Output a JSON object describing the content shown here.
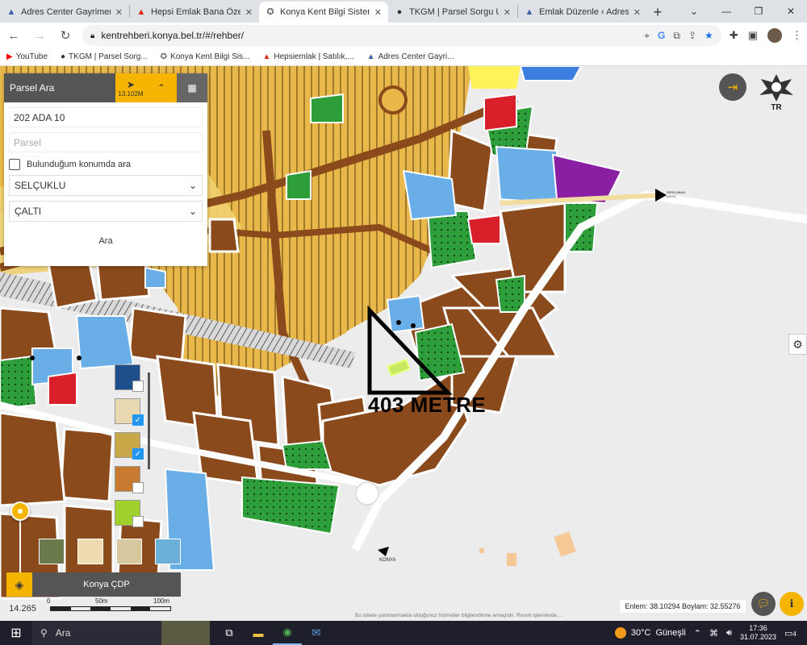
{
  "browser": {
    "tabs": [
      {
        "title": "Adres Center Gayrimenkul",
        "icon": "adres-center-icon",
        "active": false
      },
      {
        "title": "Hepsi Emlak Bana Özel",
        "icon": "hepsiemlak-icon",
        "active": false
      },
      {
        "title": "Konya Kent Bilgi Sistemi",
        "icon": "konya-icon",
        "active": true
      },
      {
        "title": "TKGM | Parsel Sorgu Uyg",
        "icon": "location-pin-icon",
        "active": false
      },
      {
        "title": "Emlak Düzenle ‹ Adres Ce",
        "icon": "adres-center-icon",
        "active": false
      }
    ],
    "url": "kentrehberi.konya.bel.tr/#/rehber/",
    "bookmarks": [
      {
        "label": "YouTube",
        "icon": "youtube-icon"
      },
      {
        "label": "TKGM | Parsel Sorg...",
        "icon": "location-pin-icon"
      },
      {
        "label": "Konya Kent Bilgi Sis...",
        "icon": "konya-icon"
      },
      {
        "label": "Hepsiemlak | Satılık,...",
        "icon": "hepsiemlak-icon"
      },
      {
        "label": "Adres Center Gayri...",
        "icon": "adres-center-icon"
      }
    ]
  },
  "panel": {
    "title": "Parsel Ara",
    "scale": "13.102M",
    "ada_value": "202 ADA 10",
    "parsel_placeholder": "Parsel",
    "location_checkbox": "Bulunduğum konumda ara",
    "ilce": "SELÇUKLU",
    "mahalle": "ÇALTI",
    "search_button": "Ara"
  },
  "map": {
    "annotation": "403 METRE",
    "logo_text": "TR",
    "place_label": "KONYA",
    "road_label": "SERDUMAN KÖYÜ",
    "layer_name": "Konya ÇDP",
    "zoom_level": "14.265",
    "scale_labels": [
      "0",
      "50m",
      "100m"
    ],
    "coordinates": "Enlem: 38.10294 Boylam: 32.55276",
    "cookie_notice": "Bu sitede yararlanmakta olduğunuz hizmetler bilgilendirme amaçlıdır. Resmi işlemlerde..."
  },
  "taskbar": {
    "search_label": "Ara",
    "temperature": "30°C",
    "weather": "Güneşli",
    "time": "17:36",
    "date": "31.07.2023",
    "notif_count": "4"
  },
  "colors": {
    "accent": "#f4b400",
    "residential": "#8b4a1c",
    "agriculture": "#e8b84a",
    "green": "#2e9e3a",
    "water": "#6aaee8"
  }
}
